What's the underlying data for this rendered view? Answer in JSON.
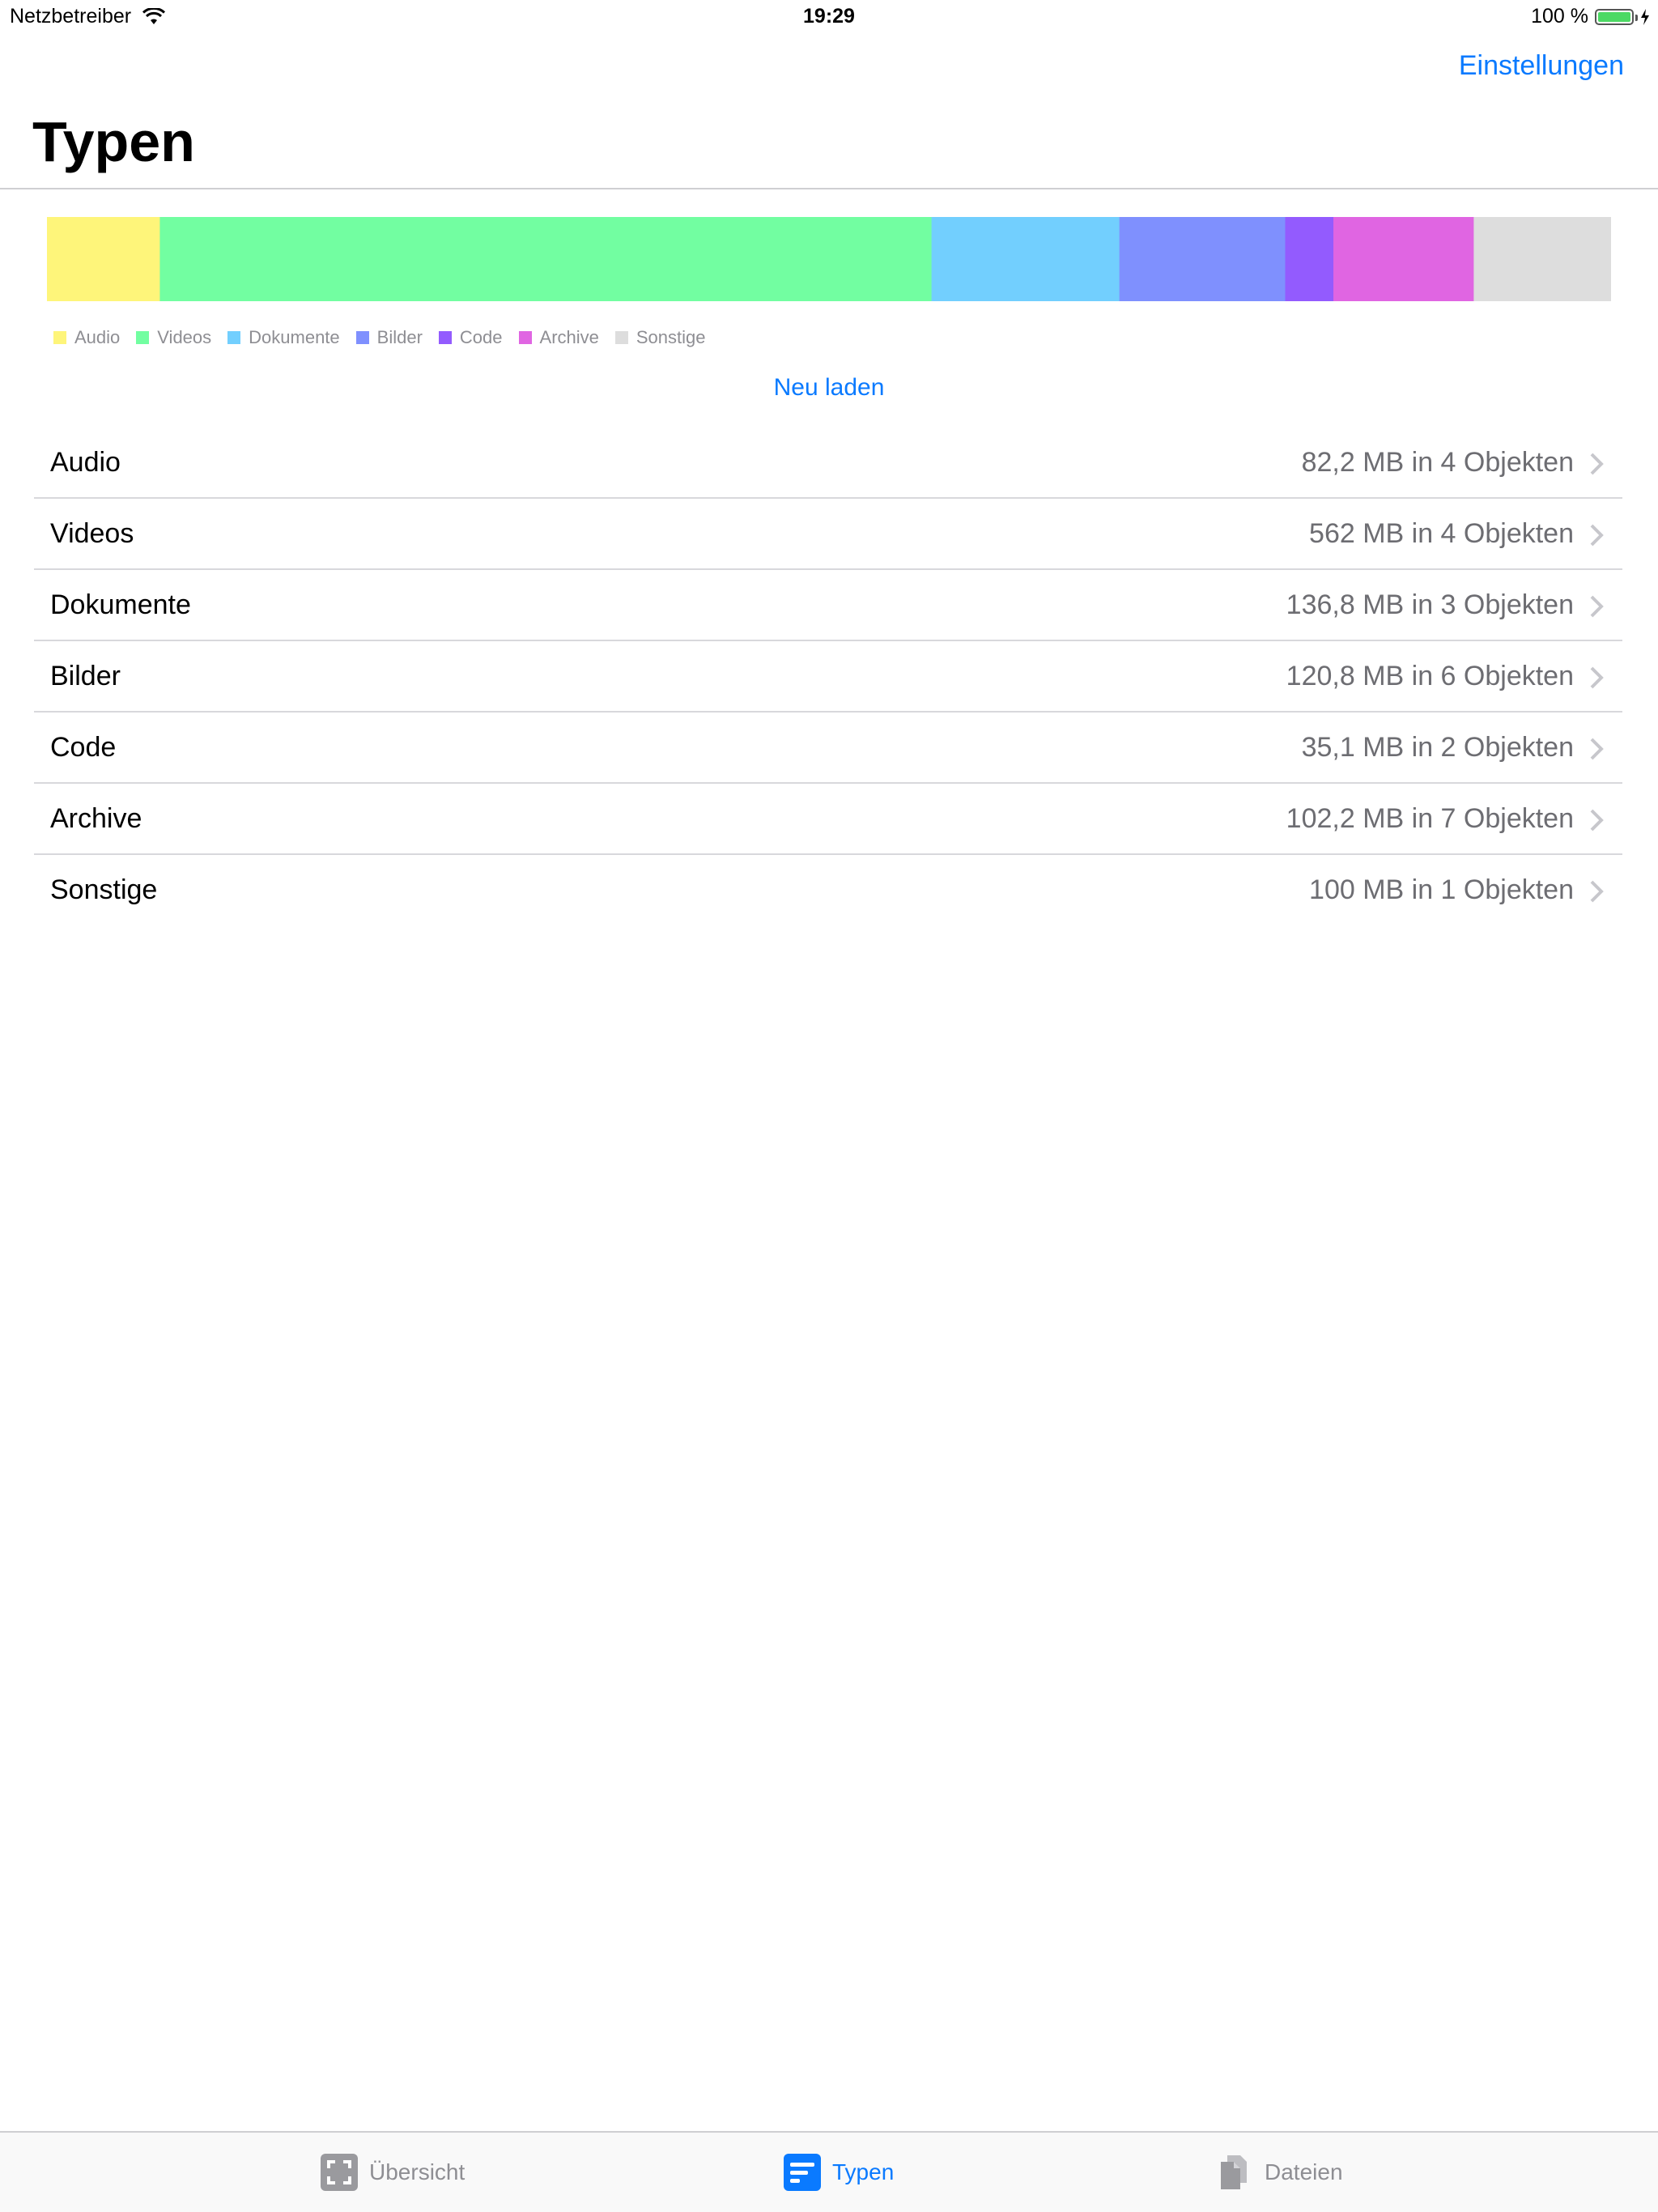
{
  "status_bar": {
    "carrier": "Netzbetreiber",
    "time": "19:29",
    "battery": "100 %"
  },
  "nav": {
    "title": "Typen",
    "settings_label": "Einstellungen"
  },
  "colors": {
    "accent": "#0a7aff"
  },
  "chart_data": {
    "type": "bar",
    "categories": [
      "Audio",
      "Videos",
      "Dokumente",
      "Bilder",
      "Code",
      "Archive",
      "Sonstige"
    ],
    "values": [
      82.2,
      562,
      136.8,
      120.8,
      35.1,
      102.2,
      100
    ],
    "colors": [
      "#fef57a",
      "#72fea1",
      "#72cffe",
      "#7f90fe",
      "#935bfe",
      "#e065e2",
      "#dddddd"
    ],
    "legend_placement": "bottom-left",
    "grid": false,
    "stacked": true
  },
  "reload_label": "Neu laden",
  "rows": [
    {
      "label": "Audio",
      "detail": "82,2 MB in 4 Objekten"
    },
    {
      "label": "Videos",
      "detail": "562 MB in 4 Objekten"
    },
    {
      "label": "Dokumente",
      "detail": "136,8 MB in 3 Objekten"
    },
    {
      "label": "Bilder",
      "detail": "120,8 MB in 6 Objekten"
    },
    {
      "label": "Code",
      "detail": "35,1 MB in 2 Objekten"
    },
    {
      "label": "Archive",
      "detail": "102,2 MB in 7 Objekten"
    },
    {
      "label": "Sonstige",
      "detail": "100 MB in 1 Objekten"
    }
  ],
  "tabs": [
    {
      "label": "Übersicht",
      "icon": "overview-icon",
      "active": false
    },
    {
      "label": "Typen",
      "icon": "types-icon",
      "active": true
    },
    {
      "label": "Dateien",
      "icon": "files-icon",
      "active": false
    }
  ]
}
